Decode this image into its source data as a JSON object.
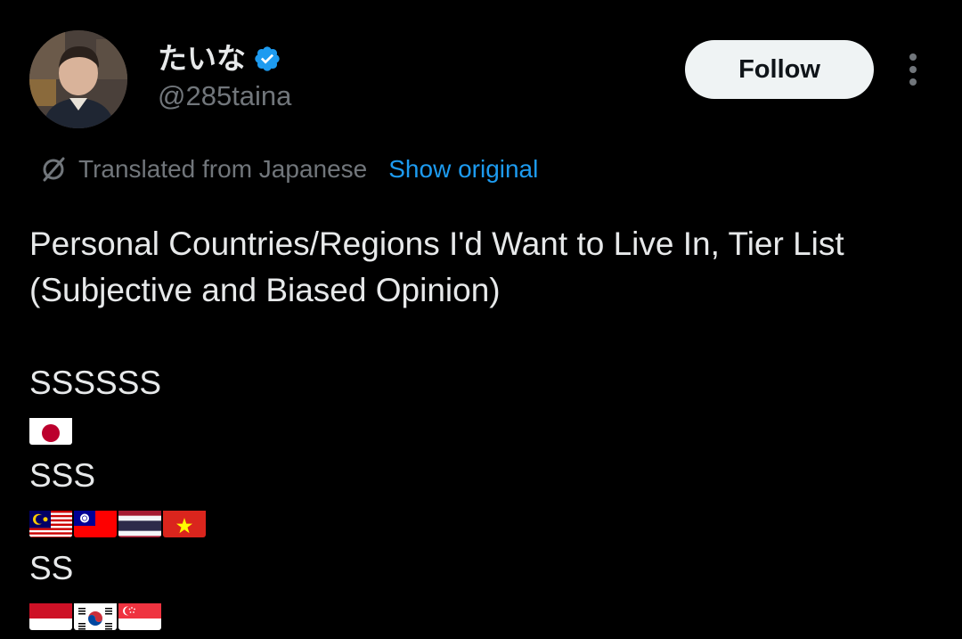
{
  "author": {
    "display_name": "たいな",
    "handle": "@285taina",
    "verified": true
  },
  "actions": {
    "follow_label": "Follow",
    "more_icon": "more-vertical-icon"
  },
  "translation": {
    "label": "Translated from Japanese",
    "show_original_label": "Show original",
    "icon": "translate-icon"
  },
  "tweet": {
    "title_line1": "Personal Countries/Regions I'd Want to Live In, Tier List",
    "title_line2": "(Subjective and Biased Opinion)",
    "tiers": [
      {
        "label": "SSSSSS",
        "flags": [
          "japan"
        ]
      },
      {
        "label": "SSS",
        "flags": [
          "malaysia",
          "taiwan",
          "thailand",
          "vietnam"
        ]
      },
      {
        "label": "SS",
        "flags": [
          "indonesia",
          "south-korea",
          "singapore"
        ]
      }
    ]
  },
  "colors": {
    "background": "#000000",
    "text": "#e7e9ea",
    "muted": "#71767b",
    "link": "#1d9bf0",
    "verified": "#1d9bf0",
    "follow_bg": "#eff3f4"
  }
}
